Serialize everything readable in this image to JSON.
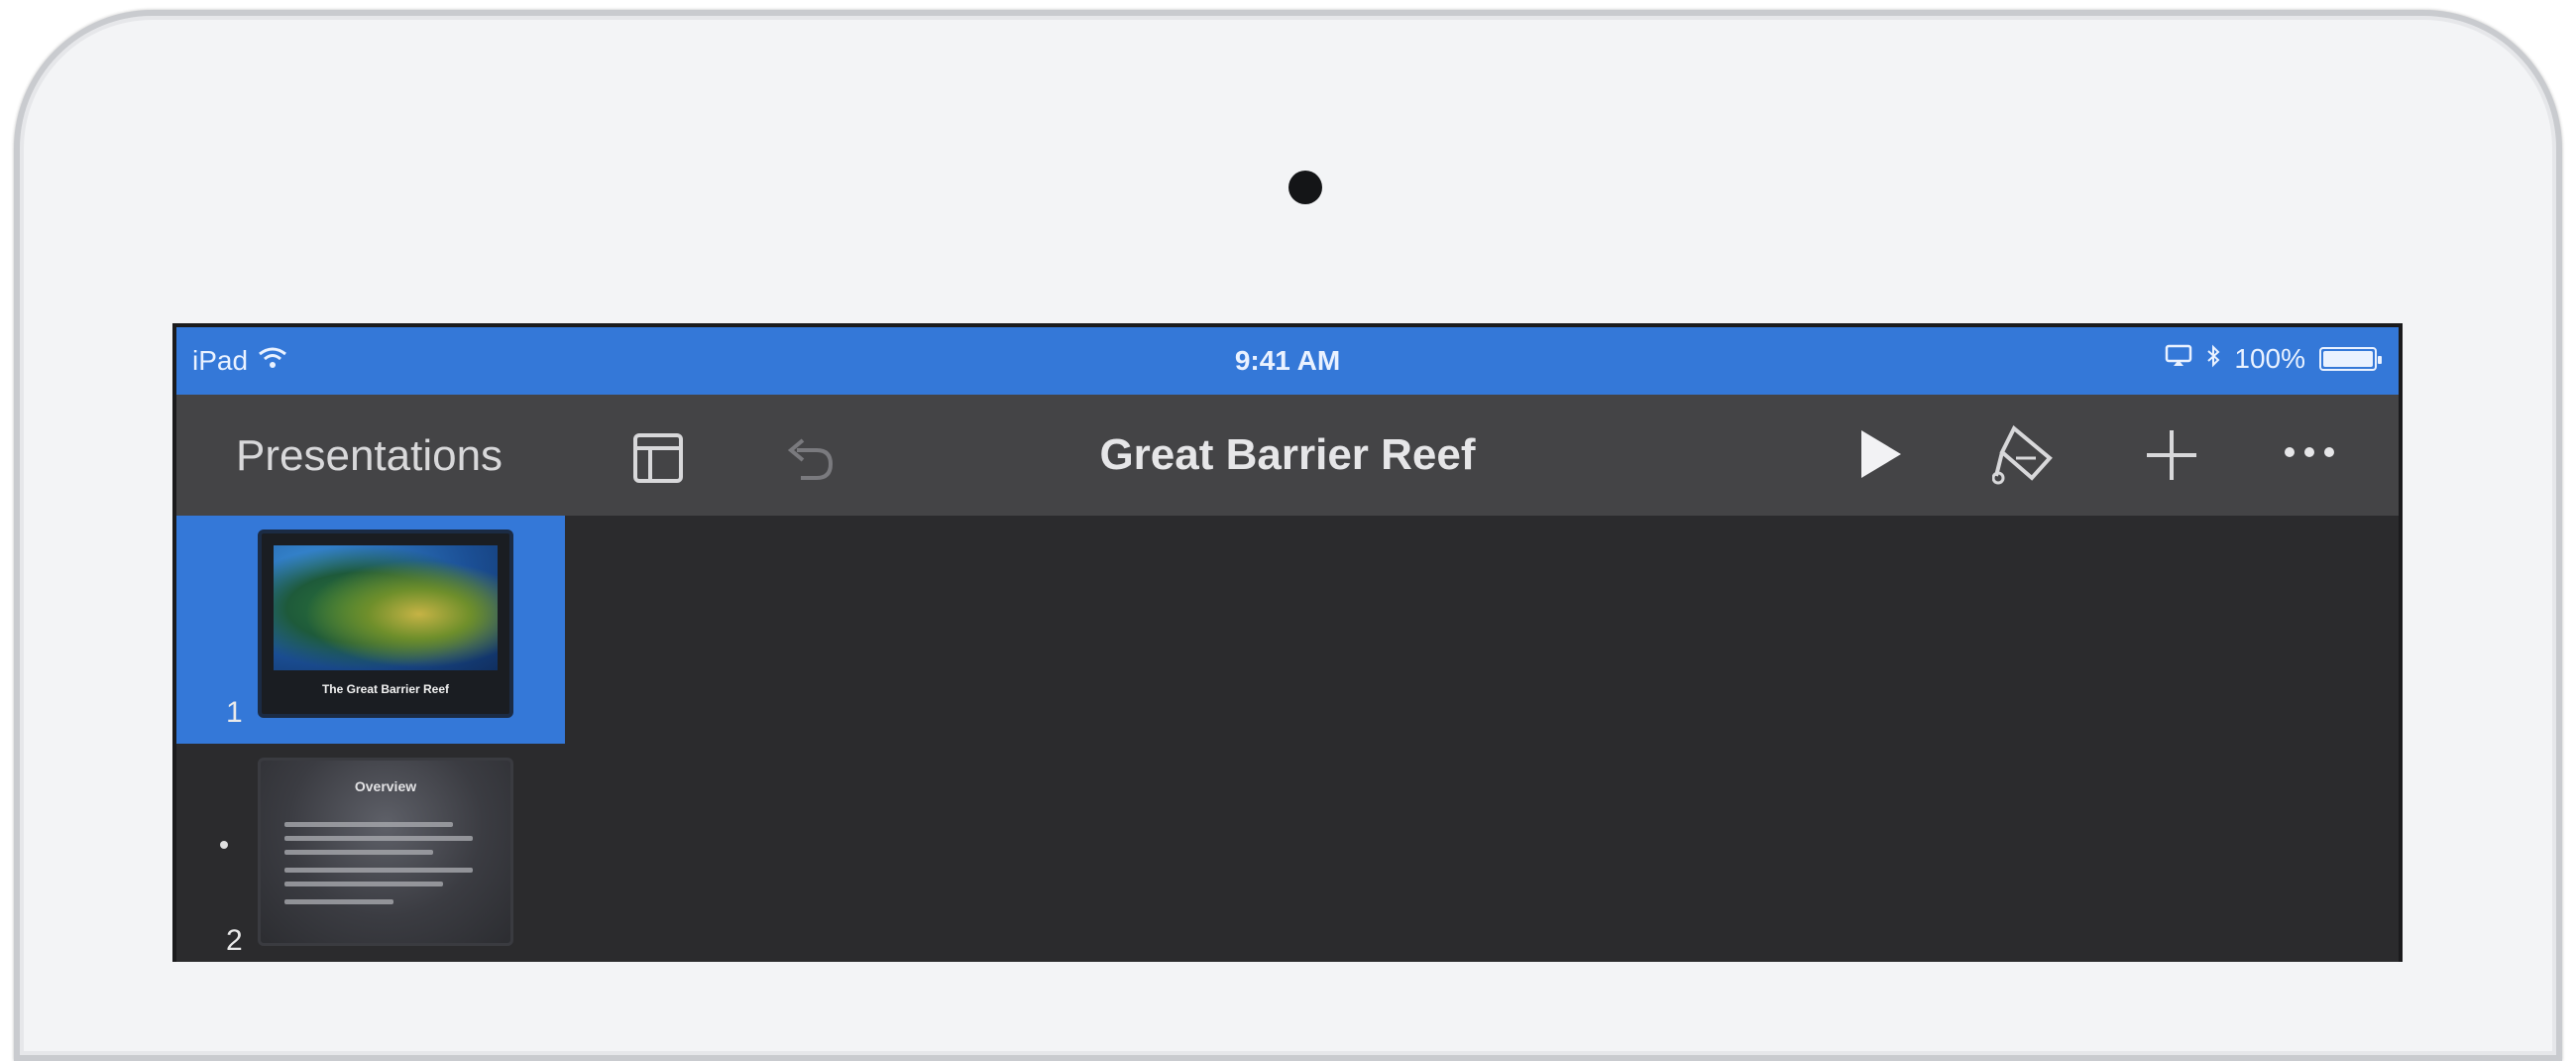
{
  "status_bar": {
    "device": "iPad",
    "time": "9:41 AM",
    "battery": "100%",
    "battery_level": 1.0
  },
  "toolbar": {
    "back_label": "Presentations",
    "title": "Great Barrier Reef",
    "icons": [
      "sidebar-icon",
      "undo-icon",
      "play-icon",
      "format-brush-icon",
      "plus-icon",
      "more-icon"
    ]
  },
  "navigator": {
    "slides": [
      {
        "number": "1",
        "caption": "The Great Barrier Reef",
        "selected": true
      },
      {
        "number": "2",
        "heading": "Overview",
        "selected": false
      }
    ]
  },
  "colors": {
    "accent": "#3478d8",
    "toolbar": "#444446",
    "background": "#2b2b2d"
  }
}
